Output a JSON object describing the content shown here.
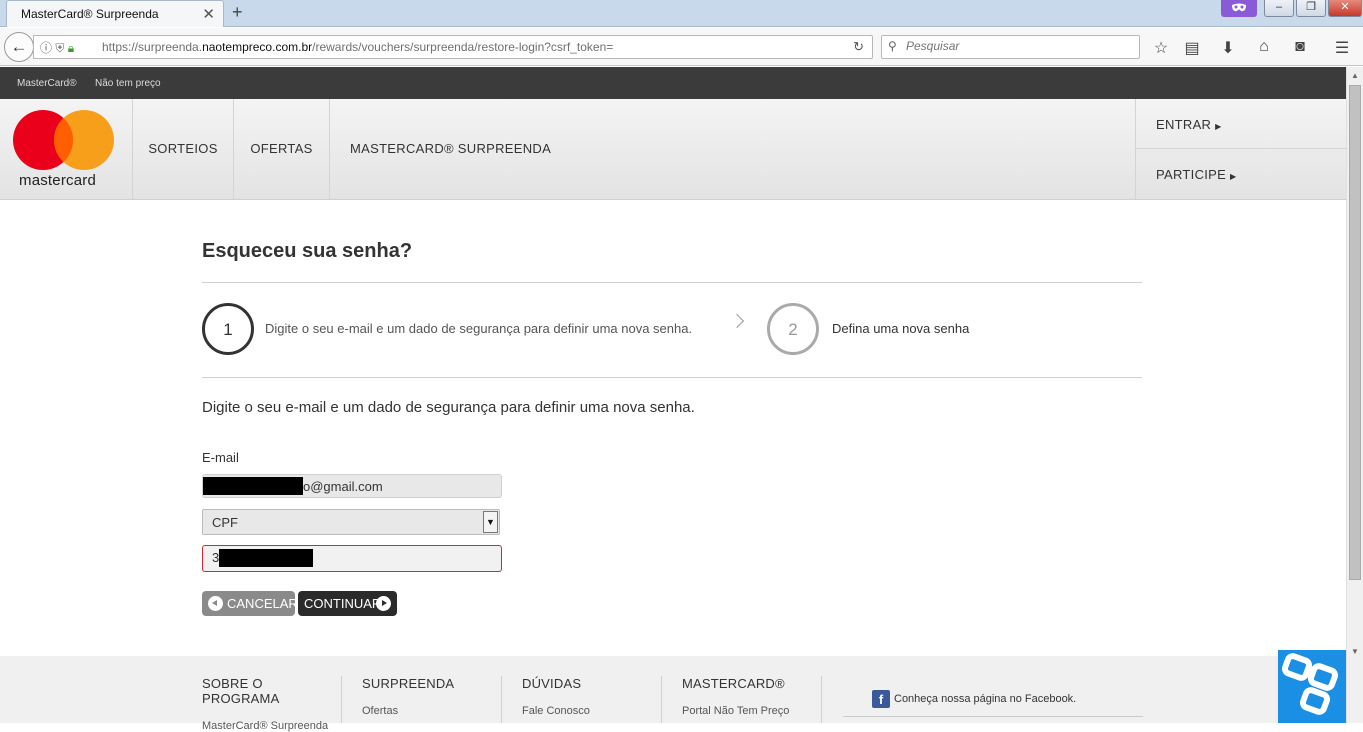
{
  "browser": {
    "tab_title": "MasterCard® Surpreenda",
    "tab_close": "✕",
    "new_tab": "+",
    "url_prefix": "https://surpreenda.",
    "url_domain": "naotempreco.com.br",
    "url_path": "/rewards/vouchers/surpreenda/restore-login?csrf_token=",
    "search_placeholder": "Pesquisar"
  },
  "topstrip": {
    "brand": "MasterCard®",
    "slogan": "Não tem preço"
  },
  "header": {
    "logo_text": "mastercard",
    "nav": [
      "SORTEIOS",
      "OFERTAS",
      "MASTERCARD® SURPREENDA"
    ],
    "login": "ENTRAR",
    "join": "PARTICIPE"
  },
  "page": {
    "title": "Esqueceu sua senha?",
    "steps": [
      {
        "number": "1",
        "text": "Digite o seu e-mail e um dado de segurança para definir uma nova senha."
      },
      {
        "number": "2",
        "text": "Defina uma nova senha"
      }
    ],
    "intro": "Digite o seu e-mail e um dado de segurança para definir uma nova senha.",
    "email_label": "E-mail",
    "email_suffix": "o@gmail.com",
    "doc_type": "CPF",
    "doc_value_prefix": "3",
    "cancel": "CANCELAR",
    "continue": "CONTINUAR"
  },
  "footer": {
    "columns": [
      {
        "title": "SOBRE O PROGRAMA",
        "link": "MasterCard® Surpreenda"
      },
      {
        "title": "SURPREENDA",
        "link": "Ofertas"
      },
      {
        "title": "DÚVIDAS",
        "link": "Fale Conosco"
      },
      {
        "title": "MASTERCARD®",
        "link": "Portal Não Tem Preço"
      }
    ],
    "facebook": "Conheça nossa página no Facebook."
  },
  "colors": {
    "mc_red": "#eb001b",
    "mc_orange": "#f79e1b",
    "dark_strip": "#3b3b3b",
    "error_border": "#dd2233"
  }
}
